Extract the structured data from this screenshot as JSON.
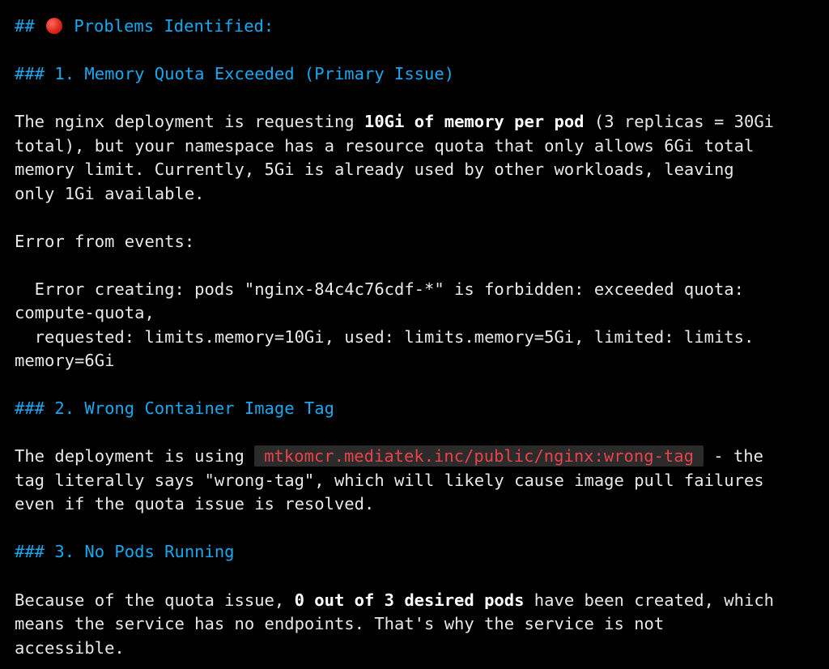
{
  "colors": {
    "background": "#000000",
    "heading": "#19a8f0",
    "text": "#e8e8e8",
    "code_text": "#e8424a",
    "code_bg": "#2b2b2b",
    "problem_dot": "#e0281c"
  },
  "icons": {
    "problems": "red-circle-icon"
  },
  "heading_main": {
    "prefix": "##",
    "title": "Problems Identified:"
  },
  "section1": {
    "heading": "### 1. Memory Quota Exceeded (Primary Issue)",
    "l1_a": "The nginx deployment is requesting ",
    "l1_bold": "10Gi of memory per pod",
    "l1_b": " (3 replicas = 30Gi",
    "l2": "total), but your namespace has a resource quota that only allows 6Gi total",
    "l3": "memory limit. Currently, 5Gi is already used by other workloads, leaving",
    "l4": "only 1Gi available.",
    "error_label": "Error from events:",
    "err1": "  Error creating: pods \"nginx-84c4c76cdf-*\" is forbidden: exceeded quota:",
    "err2": "compute-quota,",
    "err3": "  requested: limits.memory=10Gi, used: limits.memory=5Gi, limited: limits.",
    "err4": "memory=6Gi"
  },
  "section2": {
    "heading": "### 2. Wrong Container Image Tag",
    "l1_a": "The deployment is using ",
    "l1_code": "mtkomcr.mediatek.inc/public/nginx:wrong-tag",
    "l1_b": " - the",
    "l2": "tag literally says \"wrong-tag\", which will likely cause image pull failures",
    "l3": "even if the quota issue is resolved."
  },
  "section3": {
    "heading": "### 3. No Pods Running",
    "l1_a": "Because of the quota issue, ",
    "l1_bold": "0 out of 3 desired pods",
    "l1_b": " have been created, which",
    "l2": "means the service has no endpoints. That's why the service is not",
    "l3": "accessible."
  }
}
